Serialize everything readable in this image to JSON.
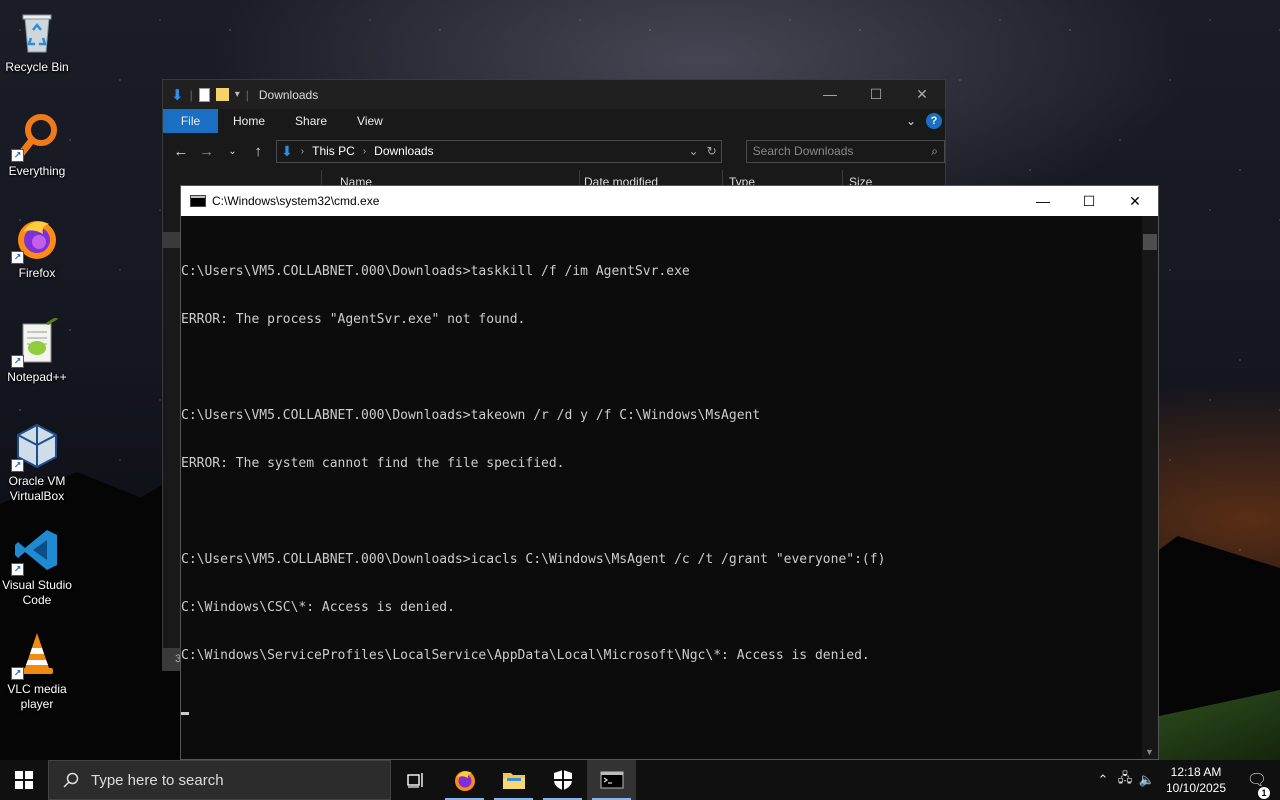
{
  "desktop": {
    "icons": [
      {
        "label": "Recycle Bin"
      },
      {
        "label": "Everything"
      },
      {
        "label": "Firefox"
      },
      {
        "label": "Notepad++"
      },
      {
        "label": "Oracle VM\nVirtualBox"
      },
      {
        "label": "Visual Studio\nCode"
      },
      {
        "label": "VLC media\nplayer"
      }
    ]
  },
  "explorer": {
    "title": "Downloads",
    "ribbon": {
      "file": "File",
      "home": "Home",
      "share": "Share",
      "view": "View",
      "help": "?"
    },
    "address": {
      "crumb1": "This PC",
      "crumb2": "Downloads"
    },
    "search_placeholder": "Search Downloads",
    "columns": {
      "name": "Name",
      "date": "Date modified",
      "type": "Type",
      "size": "Size"
    },
    "status_fragment": "3"
  },
  "cmd": {
    "title": "C:\\Windows\\system32\\cmd.exe",
    "lines": [
      "C:\\Users\\VM5.COLLABNET.000\\Downloads>taskkill /f /im AgentSvr.exe",
      "ERROR: The process \"AgentSvr.exe\" not found.",
      "",
      "C:\\Users\\VM5.COLLABNET.000\\Downloads>takeown /r /d y /f C:\\Windows\\MsAgent",
      "ERROR: The system cannot find the file specified.",
      "",
      "C:\\Users\\VM5.COLLABNET.000\\Downloads>icacls C:\\Windows\\MsAgent /c /t /grant \"everyone\":(f)",
      "C:\\Windows\\CSC\\*: Access is denied.",
      "C:\\Windows\\ServiceProfiles\\LocalService\\AppData\\Local\\Microsoft\\Ngc\\*: Access is denied."
    ]
  },
  "taskbar": {
    "search_placeholder": "Type here to search",
    "time": "12:18 AM",
    "date": "10/10/2025",
    "notification_count": "1"
  },
  "colors": {
    "accent": "#1a6fc2",
    "cmd_bg": "#0c0c0c",
    "cmd_text": "#cccccc",
    "taskbar": "#101010"
  }
}
